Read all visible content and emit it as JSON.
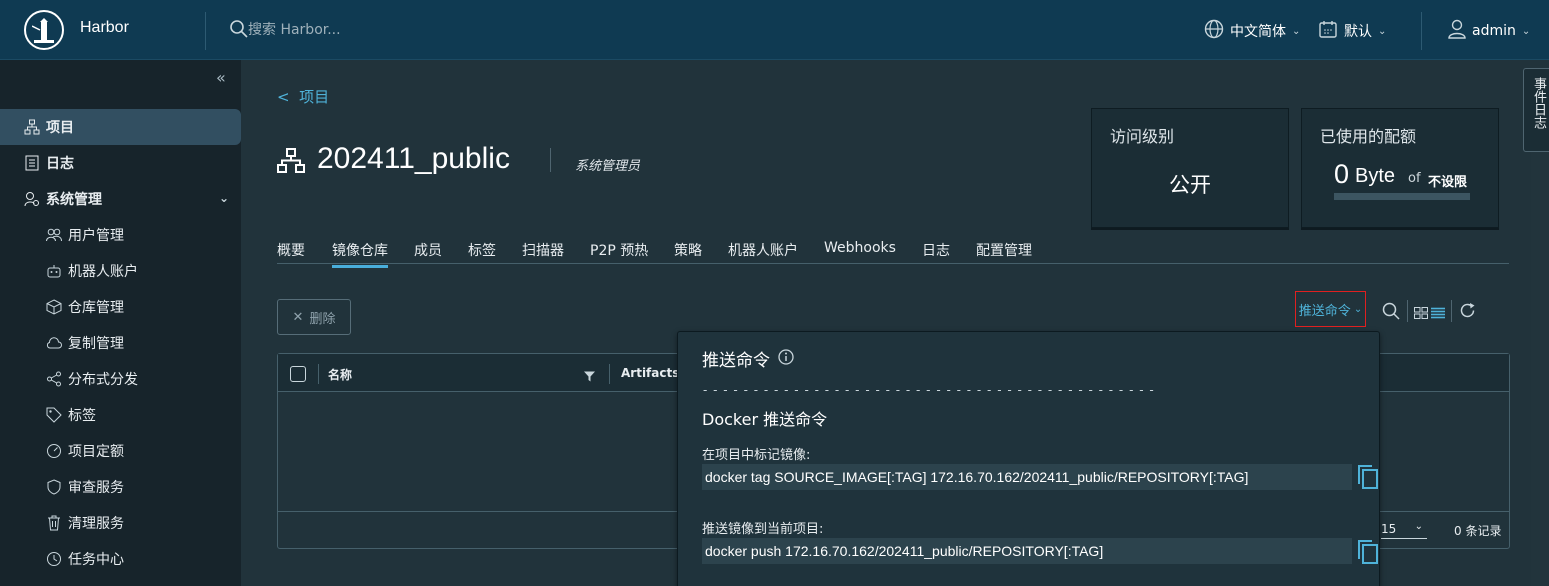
{
  "header": {
    "brand": "Harbor",
    "search_placeholder": "搜索 Harbor...",
    "language": "中文简体",
    "theme": "默认",
    "user": "admin"
  },
  "event_log_tab": "事件日志",
  "sidebar": {
    "items": [
      {
        "label": "项目",
        "icon": "project-icon",
        "active": true
      },
      {
        "label": "日志",
        "icon": "log-icon"
      },
      {
        "label": "系统管理",
        "icon": "admin-icon",
        "expandable": true
      },
      {
        "label": "用户管理",
        "icon": "users-icon"
      },
      {
        "label": "机器人账户",
        "icon": "robot-icon"
      },
      {
        "label": "仓库管理",
        "icon": "box-icon"
      },
      {
        "label": "复制管理",
        "icon": "cloud-icon"
      },
      {
        "label": "分布式分发",
        "icon": "share-icon"
      },
      {
        "label": "标签",
        "icon": "tag-icon"
      },
      {
        "label": "项目定额",
        "icon": "gauge-icon"
      },
      {
        "label": "审查服务",
        "icon": "shield-icon"
      },
      {
        "label": "清理服务",
        "icon": "trash-icon"
      },
      {
        "label": "任务中心",
        "icon": "clock-icon"
      }
    ]
  },
  "project": {
    "back_label": "项目",
    "name": "202411_public",
    "role": "系统管理员",
    "access_card": {
      "title": "访问级别",
      "value": "公开"
    },
    "quota_card": {
      "title": "已使用的配额",
      "used_number": "0",
      "used_unit": "Byte",
      "of": "of",
      "limit": "不设限",
      "used_fraction": 0
    }
  },
  "tabs": [
    "概要",
    "镜像仓库",
    "成员",
    "标签",
    "扫描器",
    "P2P 预热",
    "策略",
    "机器人账户",
    "Webhooks",
    "日志",
    "配置管理"
  ],
  "active_tab": "镜像仓库",
  "toolbar": {
    "delete_label": "删除",
    "push_command_label": "推送命令"
  },
  "grid": {
    "columns": [
      "名称",
      "Artifacts"
    ],
    "page_size": "15",
    "record_count": "0 条记录"
  },
  "popover": {
    "title": "推送命令",
    "dashes": "- - - - - - - - - - - - - - - - - - - - - - - - - - - - - - - - - - - - - - - - - - - - -",
    "docker_heading": "Docker 推送命令",
    "tag_label": "在项目中标记镜像:",
    "tag_command": "docker tag SOURCE_IMAGE[:TAG] 172.16.70.162/202411_public/REPOSITORY[:TAG]",
    "push_label": "推送镜像到当前项目:",
    "push_command": "docker push 172.16.70.162/202411_public/REPOSITORY[:TAG]"
  },
  "colors": {
    "header_bg": "#0f3a52",
    "sidebar_bg": "#17242b",
    "main_bg": "#21333b",
    "accent": "#4fb3d9",
    "highlight_border": "#e02020"
  }
}
